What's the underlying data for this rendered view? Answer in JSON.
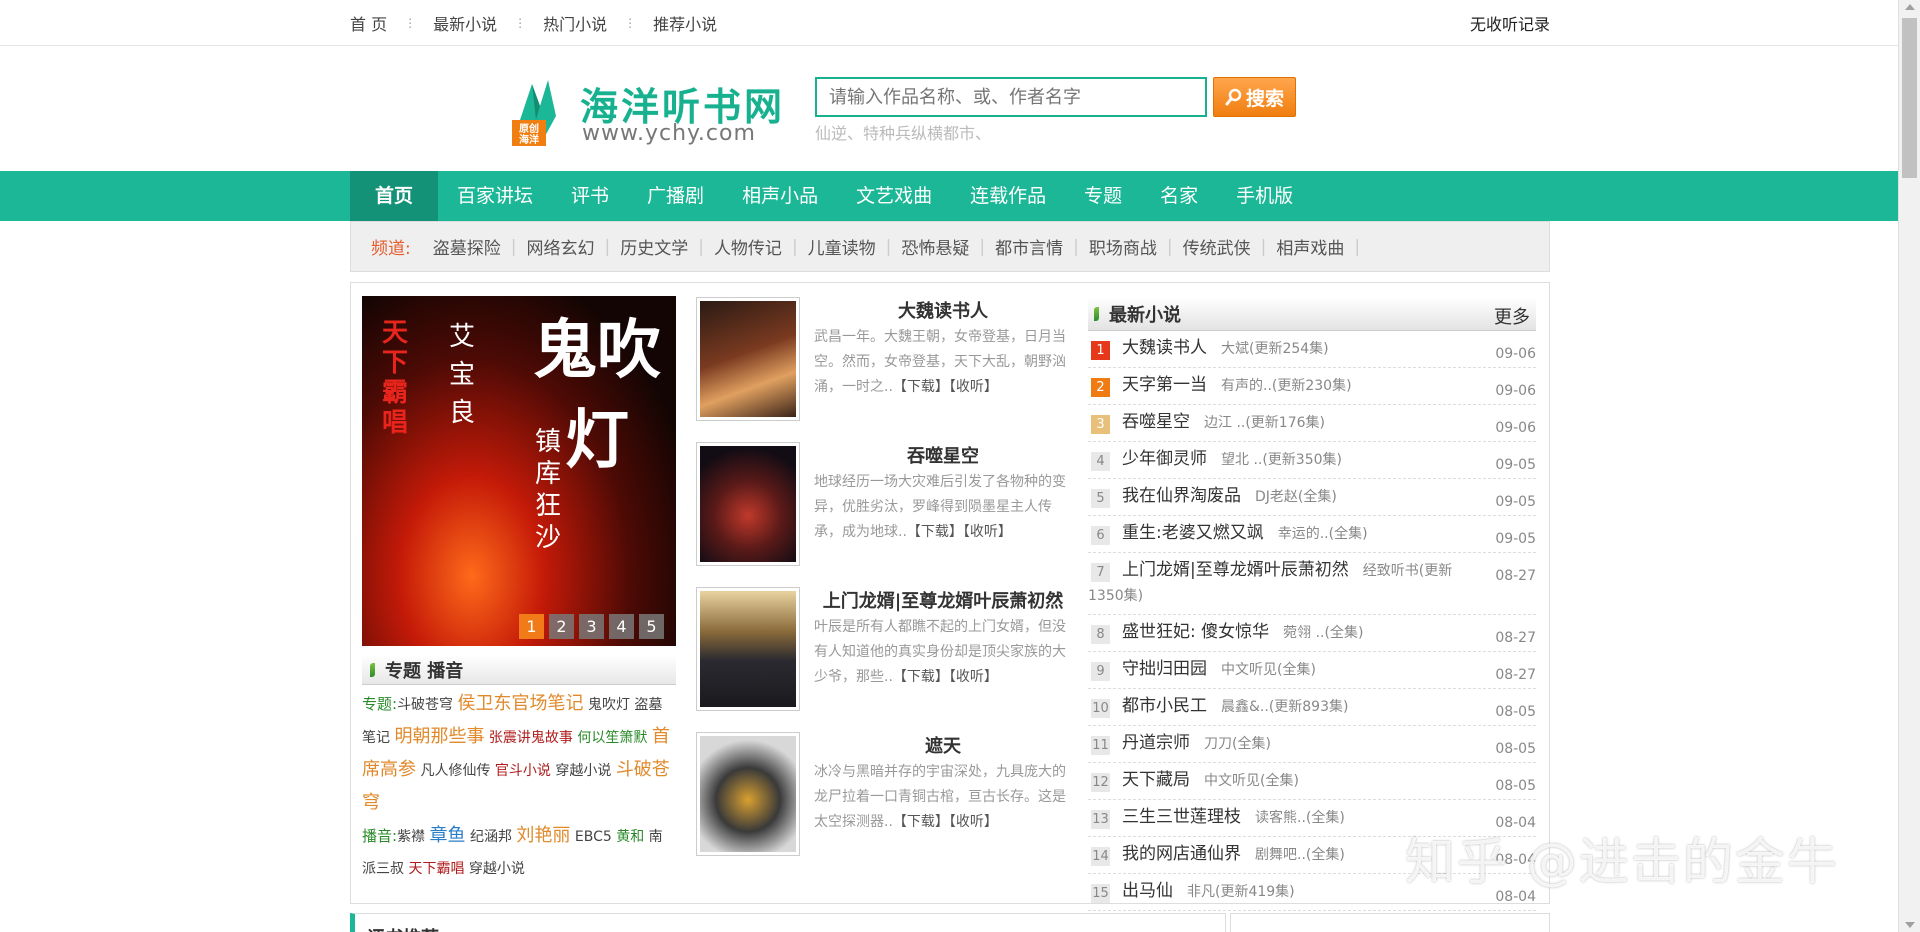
{
  "topbar": {
    "links": [
      "首 页",
      "最新小说",
      "热门小说",
      "推荐小说"
    ],
    "right_link": "无收听记录"
  },
  "header": {
    "logo_text": "海洋听书网",
    "logo_url": "www.ychy.com",
    "logo_badge": "原创海洋",
    "search_placeholder": "请输入作品名称、或、作者名字",
    "search_button": "搜索",
    "hot_words": "仙逆、特种兵纵横都市、"
  },
  "nav": {
    "items": [
      "首页",
      "百家讲坛",
      "评书",
      "广播剧",
      "相声小品",
      "文艺戏曲",
      "连载作品",
      "专题",
      "名家",
      "手机版"
    ],
    "active_index": 0
  },
  "channels": {
    "label": "频道:",
    "items": [
      "盗墓探险",
      "网络玄幻",
      "历史文学",
      "人物传记",
      "儿童读物",
      "恐怖悬疑",
      "都市言情",
      "职场商战",
      "传统武侠",
      "相声戏曲"
    ]
  },
  "slider": {
    "cover_text_left": "天下霸唱",
    "cover_text_mid": "艾宝良",
    "cover_text_title": "鬼吹灯",
    "cover_text_sub": "镇库狂沙",
    "dots": [
      "1",
      "2",
      "3",
      "4",
      "5"
    ],
    "active_dot": 0
  },
  "topics": {
    "title": "专题 播音",
    "topic_label": "专题:",
    "topic_items": [
      "斗破苍穹",
      "侯卫东官场笔记",
      "鬼吹灯",
      "盗墓笔记",
      "明朝那些事",
      "张震讲鬼故事",
      "何以笙箫默",
      "首席高参",
      "凡人修仙传",
      "官斗小说",
      "穿越小说",
      "斗破苍穹"
    ],
    "host_label": "播音:",
    "host_items": [
      "紫襟",
      "章鱼",
      "纪涵邦",
      "刘艳丽",
      "EBC5",
      "黄和",
      "南派三叔",
      "天下霸唱",
      "穿越小说"
    ]
  },
  "books": [
    {
      "title": "大魏读书人",
      "desc": "武昌一年。大魏王朝，女帝登基，日月当空。然而，女帝登基，天下大乱，朝野汹涌，一时之..",
      "download": "【下载】",
      "listen": "【收听】"
    },
    {
      "title": "吞噬星空",
      "desc": "地球经历一场大灾难后引发了各物种的变异，优胜劣汰，罗峰得到陨墨星主人传承，成为地球..",
      "download": "【下载】",
      "listen": "【收听】"
    },
    {
      "title": "上门龙婿|至尊龙婿叶辰萧初然",
      "desc": "叶辰是所有人都瞧不起的上门女婿，但没有人知道他的真实身份却是顶尖家族的大少爷，那些..",
      "download": "【下载】",
      "listen": "【收听】"
    },
    {
      "title": "遮天",
      "desc": "冰冷与黑暗并存的宇宙深处，九具庞大的龙尸拉着一口青铜古棺，亘古长存。这是太空探测器..",
      "download": "【下载】",
      "listen": "【收听】"
    }
  ],
  "latest": {
    "title": "最新小说",
    "more": "更多",
    "items": [
      {
        "num": "1",
        "name": "大魏读书人",
        "author": "大斌(更新254集)",
        "date": "09-06"
      },
      {
        "num": "2",
        "name": "天字第一当",
        "author": "有声的..(更新230集)",
        "date": "09-06"
      },
      {
        "num": "3",
        "name": "吞噬星空",
        "author": "边江 ..(更新176集)",
        "date": "09-06"
      },
      {
        "num": "4",
        "name": "少年御灵师",
        "author": "望北 ..(更新350集)",
        "date": "09-05"
      },
      {
        "num": "5",
        "name": "我在仙界淘废品",
        "author": "DJ老赵(全集)",
        "date": "09-05"
      },
      {
        "num": "6",
        "name": "重生:老婆又燃又飒",
        "author": "幸运的..(全集)",
        "date": "09-05"
      },
      {
        "num": "7",
        "name": "上门龙婿|至尊龙婿叶辰萧初然",
        "author": "经致听书(更新1350集)",
        "date": "08-27"
      },
      {
        "num": "8",
        "name": "盛世狂妃: 傻女惊华",
        "author": "菀翎 ..(全集)",
        "date": "08-27"
      },
      {
        "num": "9",
        "name": "守拙归田园",
        "author": "中文听见(全集)",
        "date": "08-27"
      },
      {
        "num": "10",
        "name": "都市小民工",
        "author": "晨鑫&..(更新893集)",
        "date": "08-05"
      },
      {
        "num": "11",
        "name": "丹道宗师",
        "author": "刀刀(全集)",
        "date": "08-05"
      },
      {
        "num": "12",
        "name": "天下藏局",
        "author": "中文听见(全集)",
        "date": "08-05"
      },
      {
        "num": "13",
        "name": "三生三世莲理枝",
        "author": "读客熊..(全集)",
        "date": "08-04"
      },
      {
        "num": "14",
        "name": "我的网店通仙界",
        "author": "剧舞吧..(全集)",
        "date": "08-04"
      },
      {
        "num": "15",
        "name": "出马仙",
        "author": "非凡(更新419集)",
        "date": "08-04"
      }
    ]
  },
  "bottom": {
    "section_title": "评书推荐"
  },
  "watermark": "知乎 @进击的金牛",
  "colors": {
    "brand_green": "#1bb796",
    "search_orange": "#f07e10",
    "channel_label": "#e65c2c"
  }
}
